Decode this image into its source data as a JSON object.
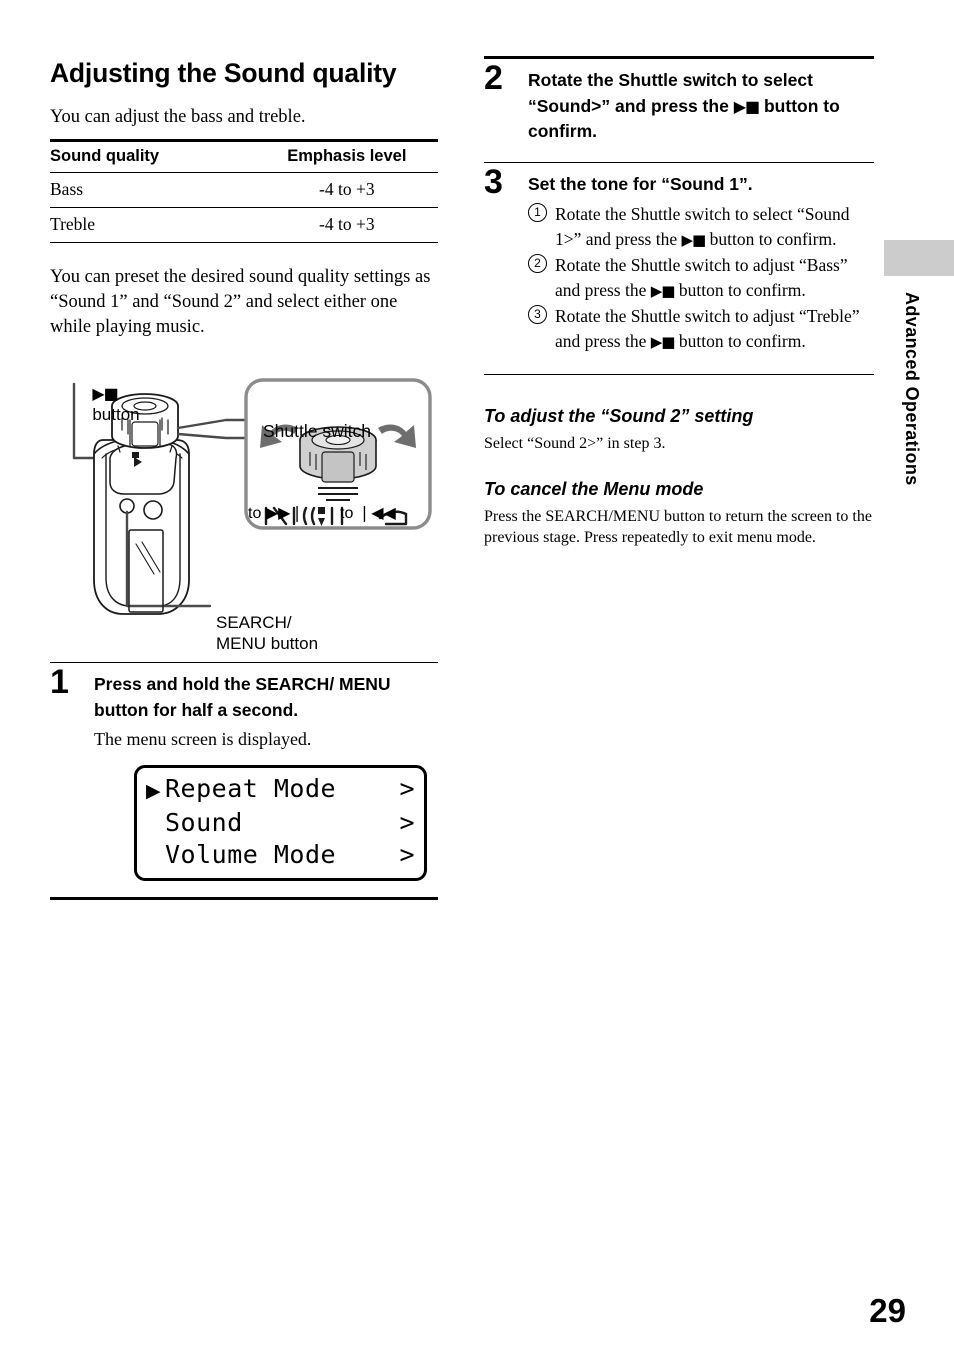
{
  "page": {
    "number": "29",
    "side_tab": "Advanced Operations",
    "side_tab_color": "#cccccc"
  },
  "left": {
    "title": "Adjusting the Sound quality",
    "intro": "You can adjust the bass and treble.",
    "table": {
      "headers": [
        "Sound quality",
        "Emphasis level"
      ],
      "rows": [
        [
          "Bass",
          "-4 to +3"
        ],
        [
          "Treble",
          "-4 to +3"
        ]
      ]
    },
    "preset_paragraph": "You can preset the desired sound quality settings as “Sound 1” and “Sound 2” and select either one while playing music.",
    "figure": {
      "play_stop_label": "button",
      "play_stop_glyph": "▶■",
      "shuttle_label": "Shuttle switch",
      "search_menu_label": "SEARCH/\nMENU button",
      "to_forward": "to ▶▶❘",
      "to_rewind": "to ❘◀◀"
    },
    "step1": {
      "number": "1",
      "heading": "Press and hold the SEARCH/ MENU button for half a second.",
      "body": "The menu screen is displayed."
    },
    "lcd": {
      "rows": [
        {
          "cursor": "▶",
          "text": "Repeat Mode",
          "arrow": ">"
        },
        {
          "cursor": "",
          "text": "Sound",
          "arrow": ">"
        },
        {
          "cursor": "",
          "text": "Volume Mode",
          "arrow": ">"
        }
      ]
    }
  },
  "right": {
    "step2": {
      "number": "2",
      "heading_a": "Rotate the Shuttle switch to select “Sound>” and press the",
      "glyph": "▶■",
      "heading_b": "button to confirm."
    },
    "step3": {
      "number": "3",
      "heading": "Set the tone for “Sound 1”.",
      "substeps": [
        {
          "marker": "1",
          "text_a": "Rotate the Shuttle switch to select “Sound 1>” and press the",
          "glyph": "▶■",
          "text_b": "button to confirm."
        },
        {
          "marker": "2",
          "text_a": "Rotate the Shuttle switch to adjust “Bass” and press the",
          "glyph": "▶■",
          "text_b": "button to confirm."
        },
        {
          "marker": "3",
          "text_a": "Rotate the Shuttle switch to adjust “Treble” and press the",
          "glyph": "▶■",
          "text_b": "button to confirm."
        }
      ]
    },
    "sound2": {
      "heading": "To adjust the “Sound 2” setting",
      "body": "Select “Sound 2>” in step 3."
    },
    "cancel": {
      "heading": "To cancel the Menu mode",
      "body": "Press the SEARCH/MENU button to return the screen to the previous stage. Press repeatedly to exit menu mode."
    }
  }
}
